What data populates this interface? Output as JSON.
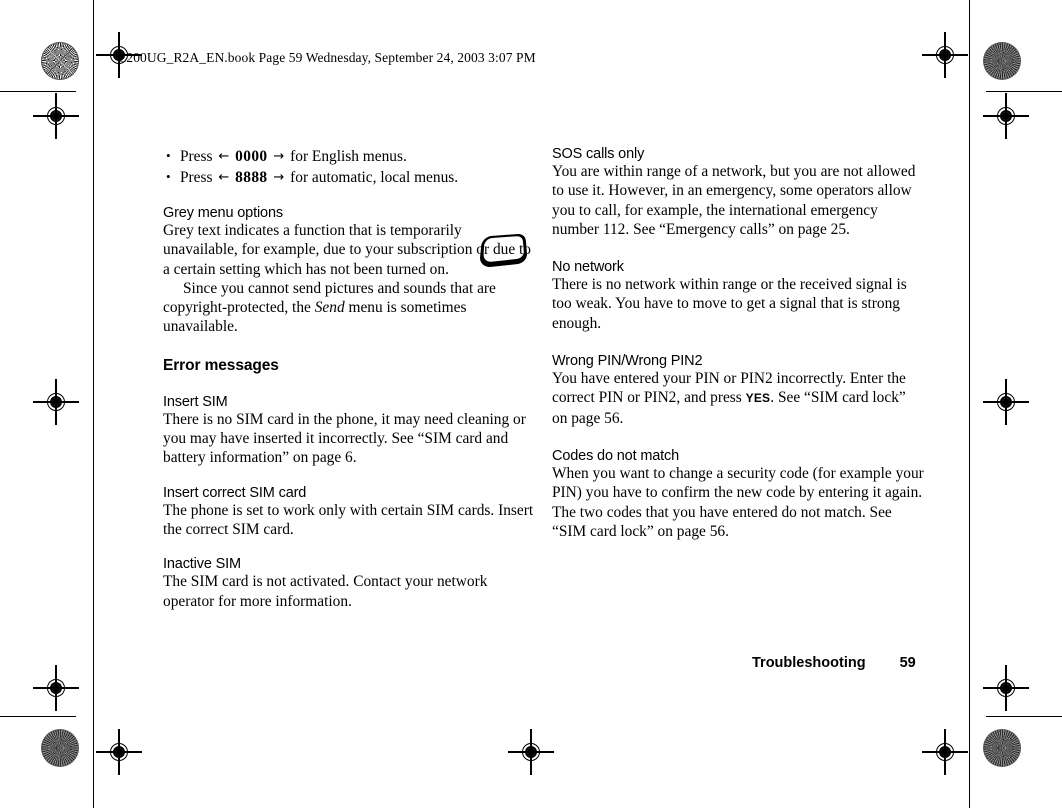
{
  "document": {
    "header_line": "Z200UG_R2A_EN.book  Page 59  Wednesday, September 24, 2003  3:07 PM",
    "footer_section": "Troubleshooting",
    "footer_page": "59"
  },
  "left_column": {
    "bullets": [
      {
        "press_label": "Press",
        "arrow_left": "←",
        "code": "0000",
        "arrow_right": "→",
        "tail": "for English menus."
      },
      {
        "press_label": "Press",
        "arrow_left": "←",
        "code": "8888",
        "arrow_right": "→",
        "tail": "for automatic, local menus."
      }
    ],
    "grey_menu": {
      "heading": "Grey menu options",
      "body": "Grey text indicates a function that is temporarily unavailable, for example, due to your subscription or due to a certain setting which has not been turned on.",
      "para2_before": "Since you cannot send pictures and sounds that are copyright-protected, the ",
      "para2_italic": "Send",
      "para2_after": " menu is sometimes unavailable."
    },
    "error_messages_heading": "Error messages",
    "sections": [
      {
        "heading": "Insert SIM",
        "body": "There is no SIM card in the phone, it may need cleaning or you may have inserted it incorrectly. See “SIM card and battery information” on page 6."
      },
      {
        "heading": "Insert correct SIM card",
        "body": "The phone is set to work only with certain SIM cards. Insert the correct SIM card."
      },
      {
        "heading": "Inactive SIM",
        "body": "The SIM card is not activated. Contact your network operator for more information."
      }
    ]
  },
  "right_column": {
    "sections": [
      {
        "heading": "SOS calls only",
        "body": "You are within range of a network, but you are not allowed to use it. However, in an emergency, some operators allow you to call, for example, the international emergency number 112. See “Emergency calls” on page 25."
      },
      {
        "heading": "No network",
        "body": "There is no network within range or the received signal is too weak. You have to move to get a signal that is strong enough."
      },
      {
        "heading": "Wrong PIN/Wrong PIN2",
        "body_before": "You have entered your PIN or PIN2 incorrectly. Enter the correct PIN or PIN2, and press ",
        "body_key": "YES",
        "body_after": ". See “SIM card lock” on page 56."
      },
      {
        "heading": "Codes do not match",
        "body": "When you want to change a security code (for example your PIN) you have to confirm the new code by entering it again. The two codes that you have entered do not match. See “SIM card lock” on page 56."
      }
    ]
  }
}
